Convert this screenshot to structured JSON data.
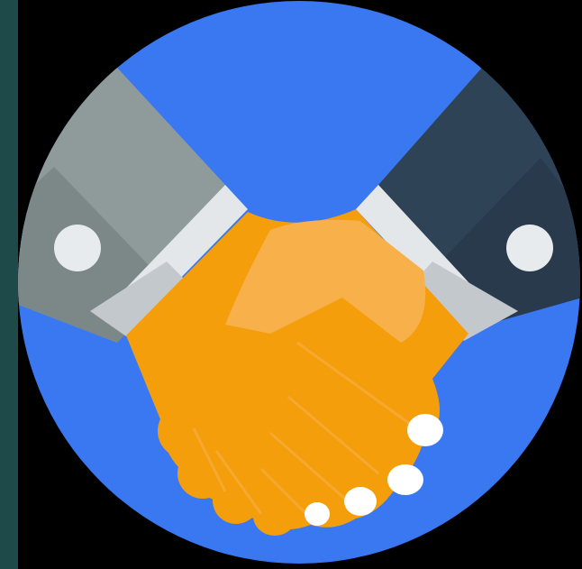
{
  "icon": {
    "name": "handshake-icon",
    "colors": {
      "background": "#000000",
      "left_strip": "#1f4a4a",
      "circle": "#3a78f2",
      "hands": "#f59e0b",
      "hands_highlight": "#f7b04a",
      "fingernail": "#ffffff",
      "left_sleeve": "#8f9b9b",
      "left_sleeve_dark": "#7c8787",
      "right_sleeve": "#2f4356",
      "right_sleeve_dark": "#283a4b",
      "cuff": "#e4e7ea",
      "cuff_shadow": "#c3c8cd",
      "button": "#e8ebee"
    }
  }
}
